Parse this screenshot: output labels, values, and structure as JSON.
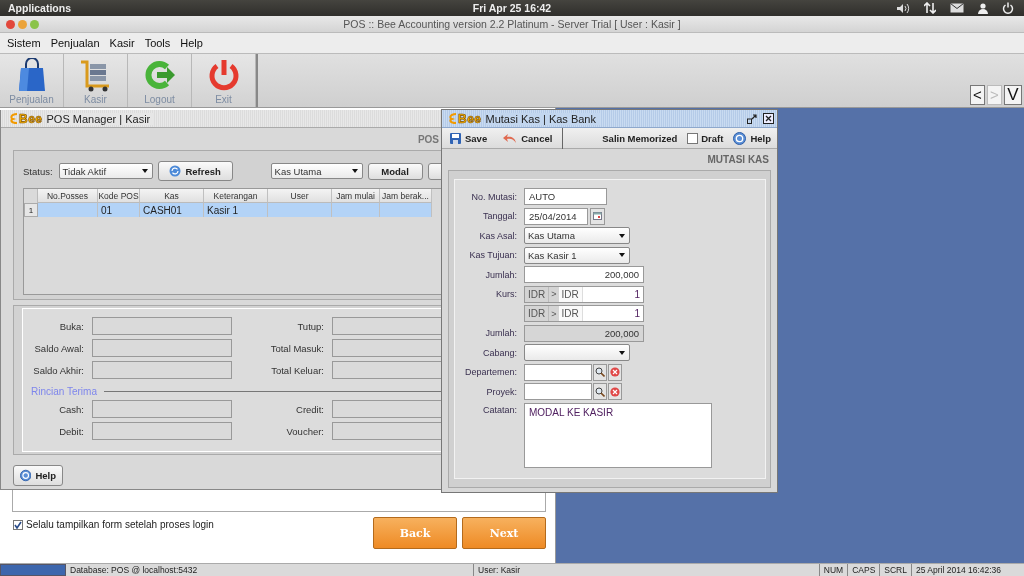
{
  "top_panel": {
    "menu": "Applications",
    "clock": "Fri Apr 25 16:42"
  },
  "window": {
    "title": "POS :: Bee Accounting version 2.2 Platinum - Server Trial [ User : Kasir ]"
  },
  "menu": [
    "Sistem",
    "Penjualan",
    "Kasir",
    "Tools",
    "Help"
  ],
  "toolbar": [
    {
      "label": "Penjualan",
      "kind": "bag"
    },
    {
      "label": "Kasir",
      "kind": "cart"
    },
    {
      "label": "Logout",
      "kind": "logout"
    },
    {
      "label": "Exit",
      "kind": "power"
    }
  ],
  "nav_buttons": [
    {
      "label": "<",
      "disabled": false
    },
    {
      "label": ">",
      "disabled": true
    },
    {
      "label": "V",
      "disabled": false
    }
  ],
  "pos_manager": {
    "logo": "Bee",
    "title": "POS Manager | Kasir",
    "heading": "POS",
    "status_label": "Status:",
    "status_value": "Tidak Aktif",
    "refresh": "Refresh",
    "kas_value": "Kas Utama",
    "modal": "Modal",
    "table": {
      "columns": [
        "No.Posses",
        "Kode POS",
        "Kas",
        "Keterangan",
        "User",
        "Jam mulai",
        "Jam berak..."
      ],
      "rows": [
        {
          "number": "1",
          "selected": true,
          "cells": [
            "",
            "01",
            "CASH01",
            "Kasir 1",
            "",
            "",
            ""
          ]
        }
      ]
    },
    "summary_fields": [
      "Buka:",
      "Tutup:",
      "Saldo Awal:",
      "Total Masuk:",
      "Saldo Akhir:",
      "Total Keluar:"
    ],
    "section": "Rincian Terima",
    "detail_fields": [
      "Cash:",
      "Credit:",
      "Debit:",
      "Voucher:"
    ],
    "help": "Help"
  },
  "login_panel": {
    "checkbox": {
      "label": "Selalu tampilkan form setelah proses login",
      "checked": true
    },
    "buttons": [
      "Back",
      "Next"
    ]
  },
  "dialog": {
    "logo": "Bee",
    "title": "Mutasi Kas | Kas Bank",
    "save": "Save",
    "cancel": "Cancel",
    "salin": "Salin Memorized",
    "draft": {
      "label": "Draft",
      "checked": false
    },
    "help": "Help",
    "heading": "MUTASI KAS",
    "fields": [
      {
        "kind": "text",
        "label": "No. Mutasi:",
        "value": "AUTO"
      },
      {
        "kind": "date",
        "label": "Tanggal:",
        "value": "25/04/2014"
      },
      {
        "kind": "select",
        "label": "Kas Asal:",
        "value": "Kas Utama"
      },
      {
        "kind": "select",
        "label": "Kas Tujuan:",
        "value": "Kas Kasir 1"
      },
      {
        "kind": "number",
        "label": "Jumlah:",
        "value": "200,000"
      },
      {
        "kind": "rate",
        "label": "Kurs:",
        "from": "IDR",
        "arrow": ">",
        "to": "IDR",
        "value": "1"
      },
      {
        "kind": "rate",
        "from": "IDR",
        "arrow": ">",
        "to": "IDR",
        "value": "1"
      },
      {
        "kind": "readonly",
        "label": "Jumlah:",
        "value": "200,000"
      },
      {
        "kind": "select",
        "label": "Cabang:"
      },
      {
        "kind": "lookup",
        "label": "Departemen:"
      },
      {
        "kind": "lookup",
        "label": "Proyek:"
      },
      {
        "kind": "memo",
        "label": "Catatan:",
        "value": "MODAL KE KASIR"
      }
    ]
  },
  "status_bar": {
    "database": "Database: POS @ localhost:5432",
    "user": "User: Kasir",
    "indicators": [
      "NUM",
      "CAPS",
      "SCRL"
    ],
    "datetime": "25 April 2014  16:42:36"
  }
}
